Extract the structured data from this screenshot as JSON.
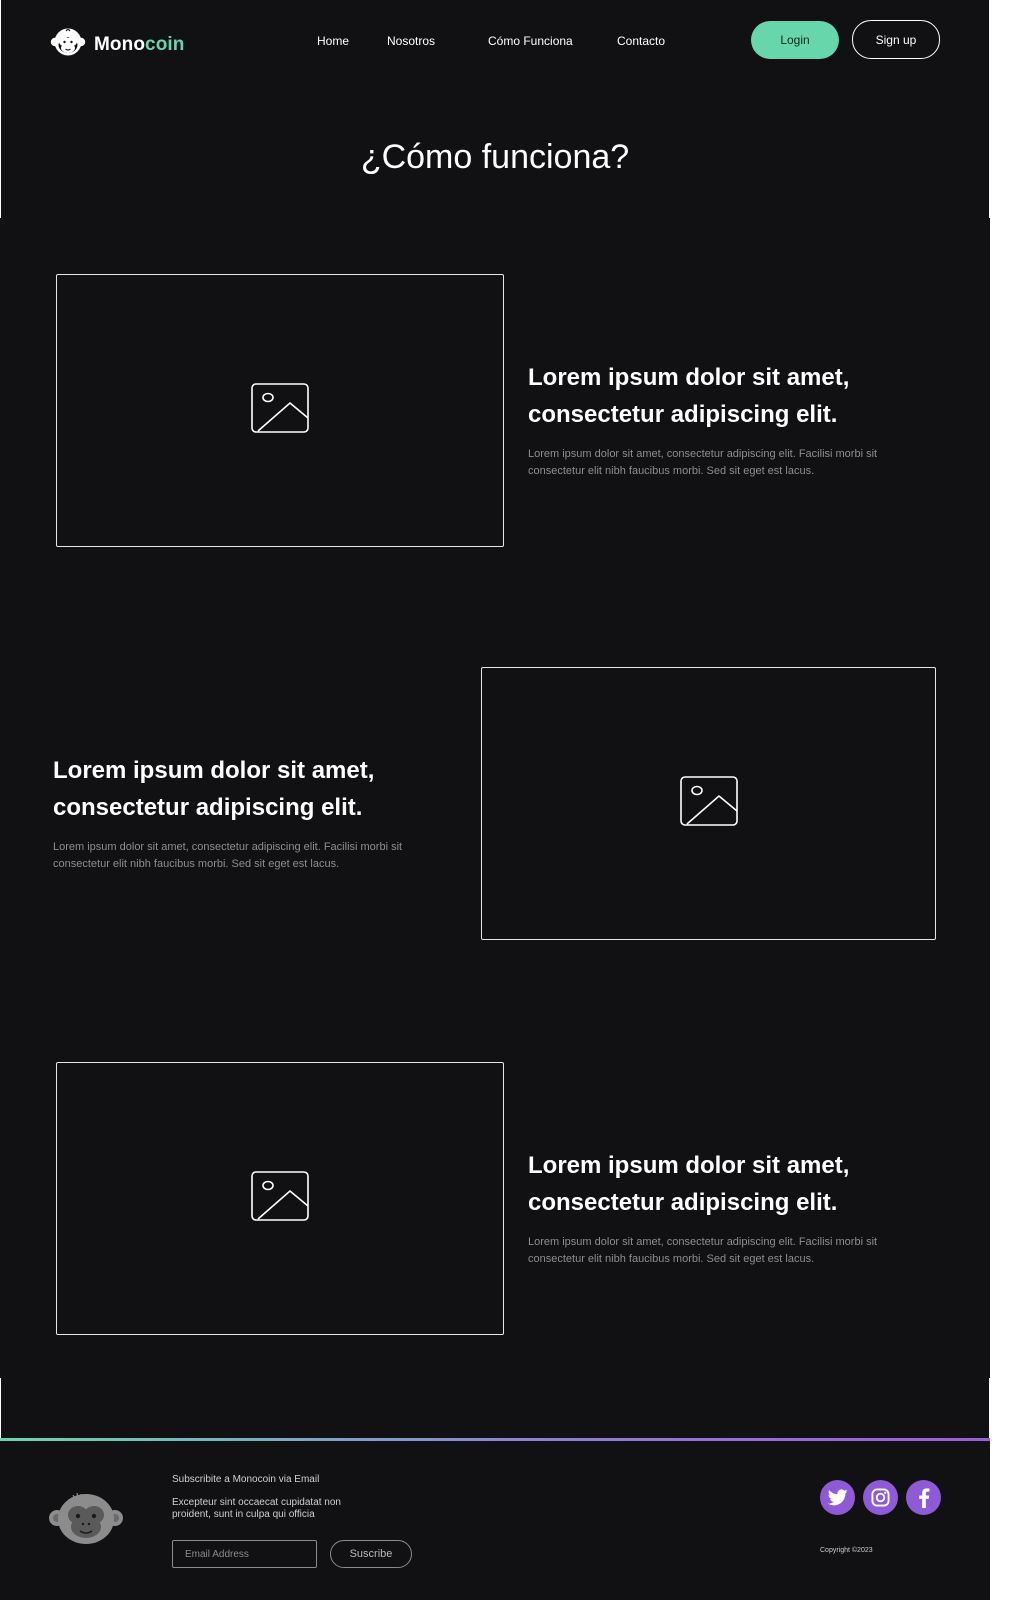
{
  "header": {
    "logo": {
      "part1": "Mono",
      "part2": "coin",
      "icon": "monkey-face-icon"
    },
    "nav": [
      "Home",
      "Nosotros",
      "Cómo Funciona",
      "Contacto"
    ],
    "login_label": "Login",
    "signup_label": "Sign up"
  },
  "page_title": "¿Cómo funciona?",
  "features": [
    {
      "heading": "Lorem ipsum dolor sit amet, consectetur adipiscing elit.",
      "text": "Lorem ipsum dolor sit amet, consectetur adipiscing elit. Facilisi morbi sit consectetur elit nibh faucibus morbi. Sed sit eget est lacus.",
      "image_icon": "image-placeholder-icon"
    },
    {
      "heading": "Lorem ipsum dolor sit amet, consectetur adipiscing elit.",
      "text": "Lorem ipsum dolor sit amet, consectetur adipiscing elit. Facilisi morbi sit consectetur elit nibh faucibus morbi. Sed sit eget est lacus.",
      "image_icon": "image-placeholder-icon"
    },
    {
      "heading": "Lorem ipsum dolor sit amet, consectetur adipiscing elit.",
      "text": "Lorem ipsum dolor sit amet, consectetur adipiscing elit. Facilisi morbi sit consectetur elit nibh faucibus morbi. Sed sit eget est lacus.",
      "image_icon": "image-placeholder-icon"
    }
  ],
  "footer": {
    "subscribe_title": "Subscribite a Monocoin via Email",
    "subscribe_text": "Excepteur sint occaecat cupidatat non proident, sunt in culpa qui officia",
    "email_placeholder": "Email Address",
    "subscribe_button": "Suscribe",
    "social": [
      "twitter-icon",
      "instagram-icon",
      "facebook-icon"
    ],
    "copyright": "Copyright ©2023"
  },
  "colors": {
    "background": "#111113",
    "accent_green": "#67d7ab",
    "accent_purple": "#8e5ad6",
    "text_muted": "#8d8d92"
  }
}
